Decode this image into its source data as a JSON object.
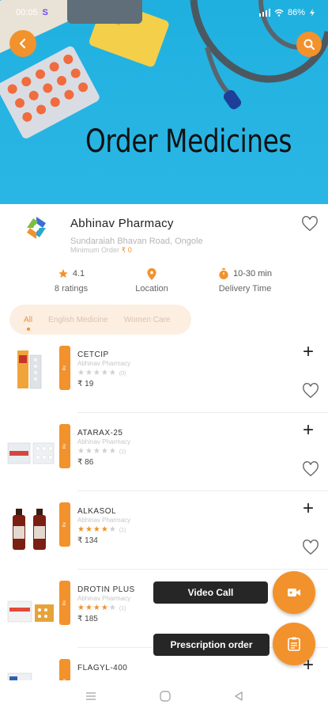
{
  "status_bar": {
    "time": "00:05",
    "carrier_icon": "S",
    "right_text": "86%"
  },
  "hero": {
    "title": "Order Medicines"
  },
  "pharmacy": {
    "name": "Abhinav Pharmacy",
    "address": "Sundaraiah Bhavan Road, Ongole",
    "min_order_label": "Minimum Order",
    "min_order_value": "₹ 0",
    "rating_value": "4.1",
    "rating_count": "8 ratings",
    "location_label": "Location",
    "delivery_time": "10-30 min",
    "delivery_label": "Delivery Time"
  },
  "categories": [
    {
      "label": "All",
      "active": true
    },
    {
      "label": "English Medicine",
      "active": false
    },
    {
      "label": "Women Care",
      "active": false
    }
  ],
  "products": [
    {
      "name": "CETCIP",
      "shop": "Abhinav Pharmacy",
      "stars": 0,
      "count": "(0)",
      "price": "₹ 19",
      "tag": "Rx"
    },
    {
      "name": "ATARAX-25",
      "shop": "Abhinav Pharmacy",
      "stars": 0,
      "count": "(1)",
      "price": "₹ 86",
      "tag": "Rx"
    },
    {
      "name": "ALKASOL",
      "shop": "Abhinav Pharmacy",
      "stars": 4,
      "count": "(1)",
      "price": "₹ 134",
      "tag": "Rx"
    },
    {
      "name": "DROTIN PLUS",
      "shop": "Abhinav Pharmacy",
      "stars": 4,
      "count": "(1)",
      "price": "₹ 185",
      "tag": "Rx"
    },
    {
      "name": "FLAGYL-400",
      "shop": "Abhinav Pharmacy",
      "stars": 0,
      "count": "",
      "price": "",
      "tag": "Rx"
    }
  ],
  "actions": {
    "video_call": "Video Call",
    "prescription_order": "Prescription order"
  },
  "colors": {
    "accent": "#f2922c",
    "hero_bg": "#27b4e3",
    "label_bg": "#262626"
  },
  "icons": [
    "back-arrow-icon",
    "search-icon",
    "heart-icon",
    "star-icon",
    "location-pin-icon",
    "stopwatch-icon",
    "plus-icon",
    "video-camera-icon",
    "clipboard-icon",
    "menu-icon",
    "home-circle-icon",
    "back-triangle-icon"
  ]
}
